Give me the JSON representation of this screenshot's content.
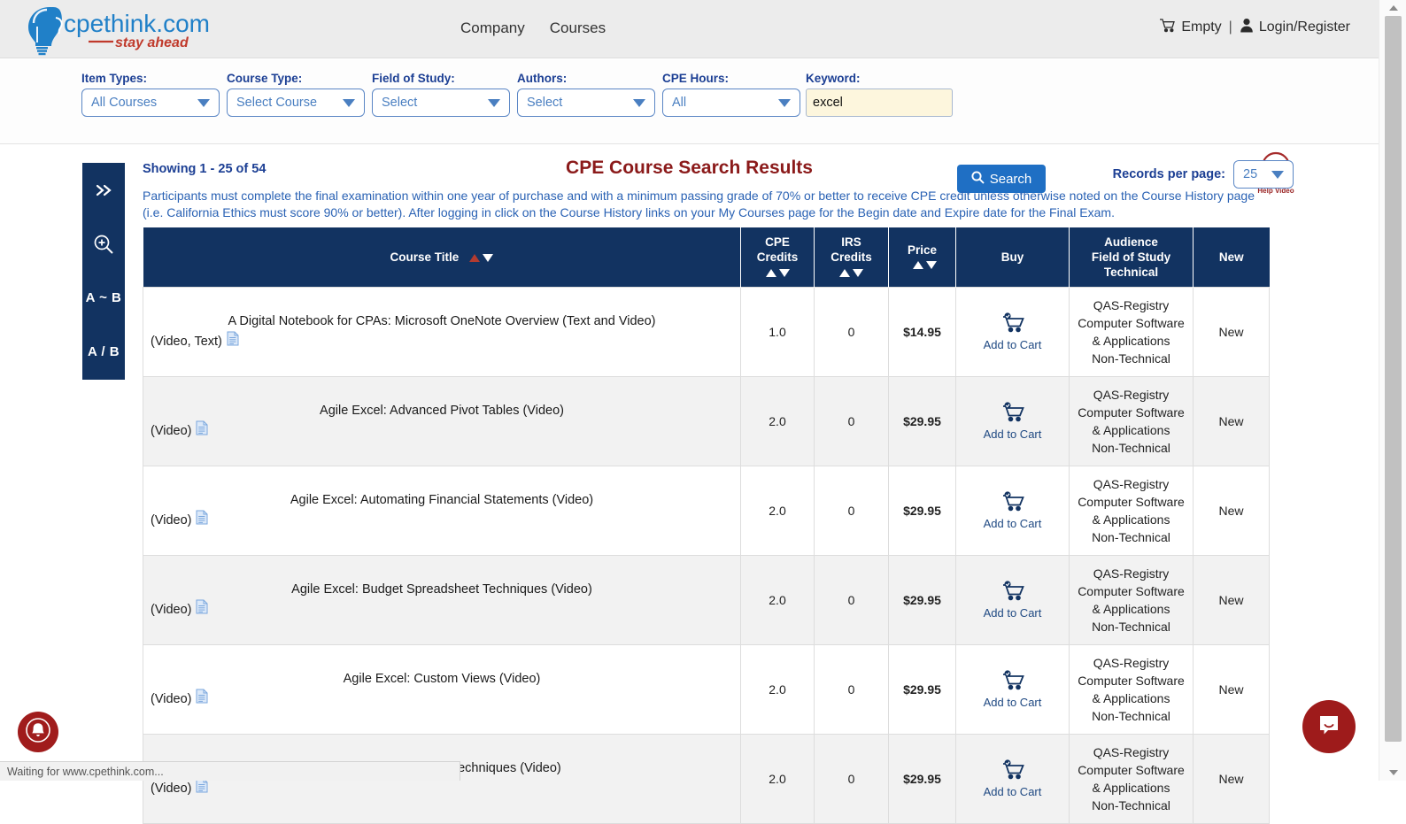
{
  "header": {
    "logo_main": "cpethink.com",
    "logo_tagline": "stay ahead",
    "nav": [
      {
        "label": "Company"
      },
      {
        "label": "Courses"
      }
    ],
    "cart_status": "Empty",
    "separator": "|",
    "account_label": "Login/Register",
    "cart_icon": "shopping-cart-icon",
    "user_icon": "user-icon"
  },
  "filters": {
    "item_types": {
      "label": "Item Types:",
      "value": "All Courses"
    },
    "course_type": {
      "label": "Course Type:",
      "value": "Select Course"
    },
    "field_of_study": {
      "label": "Field of Study:",
      "value": "Select"
    },
    "authors": {
      "label": "Authors:",
      "value": "Select"
    },
    "cpe_hours": {
      "label": "CPE Hours:",
      "value": "All"
    },
    "keyword": {
      "label": "Keyword:",
      "value": "excel",
      "placeholder": ""
    },
    "search_button": "Search",
    "help_video_label": "Help Video"
  },
  "sidebar_tools": [
    {
      "name": "expand",
      "label": "»"
    },
    {
      "name": "zoom-in",
      "label": ""
    },
    {
      "name": "a-tilde-b",
      "label": "A ~ B"
    },
    {
      "name": "a-slash-b",
      "label": "A / B"
    }
  ],
  "results": {
    "showing": "Showing 1 - 25 of 54",
    "title": "CPE Course Search Results",
    "records_per_page_label": "Records per page:",
    "records_per_page_value": "25",
    "disclaimer": "Participants must complete the final examination within one year of purchase and with a minimum passing grade of 70% or better to receive CPE credit unless otherwise noted on the Course History page (i.e. California Ethics must score 90% or better). After logging in click on the Course History links on your My Courses page for the Begin date and Expire date for the Final Exam.",
    "columns": {
      "course_title": "Course Title",
      "cpe_credits": "CPE Credits",
      "irs_credits": "IRS Credits",
      "price": "Price",
      "buy": "Buy",
      "audience_line1": "Audience",
      "audience_line2": "Field of Study",
      "audience_line3": "Technical",
      "new": "New"
    },
    "add_to_cart_label": "Add to Cart",
    "rows": [
      {
        "title": "A Digital Notebook for CPAs: Microsoft OneNote Overview (Text and Video)",
        "formats": "(Video, Text)",
        "cpe_credits": "1.0",
        "irs_credits": "0",
        "price": "$14.95",
        "audience": "QAS-Registry",
        "field_of_study": "Computer Software & Applications",
        "technical": "Non-Technical",
        "new": "New"
      },
      {
        "title": "Agile Excel: Advanced Pivot Tables (Video)",
        "formats": "(Video)",
        "cpe_credits": "2.0",
        "irs_credits": "0",
        "price": "$29.95",
        "audience": "QAS-Registry",
        "field_of_study": "Computer Software & Applications",
        "technical": "Non-Technical",
        "new": "New"
      },
      {
        "title": "Agile Excel: Automating Financial Statements (Video)",
        "formats": "(Video)",
        "cpe_credits": "2.0",
        "irs_credits": "0",
        "price": "$29.95",
        "audience": "QAS-Registry",
        "field_of_study": "Computer Software & Applications",
        "technical": "Non-Technical",
        "new": "New"
      },
      {
        "title": "Agile Excel: Budget Spreadsheet Techniques (Video)",
        "formats": "(Video)",
        "cpe_credits": "2.0",
        "irs_credits": "0",
        "price": "$29.95",
        "audience": "QAS-Registry",
        "field_of_study": "Computer Software & Applications",
        "technical": "Non-Technical",
        "new": "New"
      },
      {
        "title": "Agile Excel: Custom Views (Video)",
        "formats": "(Video)",
        "cpe_credits": "2.0",
        "irs_credits": "0",
        "price": "$29.95",
        "audience": "QAS-Registry",
        "field_of_study": "Computer Software & Applications",
        "technical": "Non-Technical",
        "new": "New"
      },
      {
        "title": "Agile Excel: Database Techniques (Video)",
        "formats": "(Video)",
        "cpe_credits": "2.0",
        "irs_credits": "0",
        "price": "$29.95",
        "audience": "QAS-Registry",
        "field_of_study": "Computer Software & Applications",
        "technical": "Non-Technical",
        "new": "New"
      }
    ]
  },
  "status_bar": {
    "text": "Waiting for www.cpethink.com..."
  },
  "widgets": {
    "notification_icon": "bell-icon",
    "chat_icon": "chat-bubble-icon"
  },
  "colors": {
    "header_bg": "#ececec",
    "table_header": "#123361",
    "accent_blue": "#1f6fc4",
    "accent_red": "#8b1a1a",
    "keyword_bg": "#fdf6dd"
  }
}
